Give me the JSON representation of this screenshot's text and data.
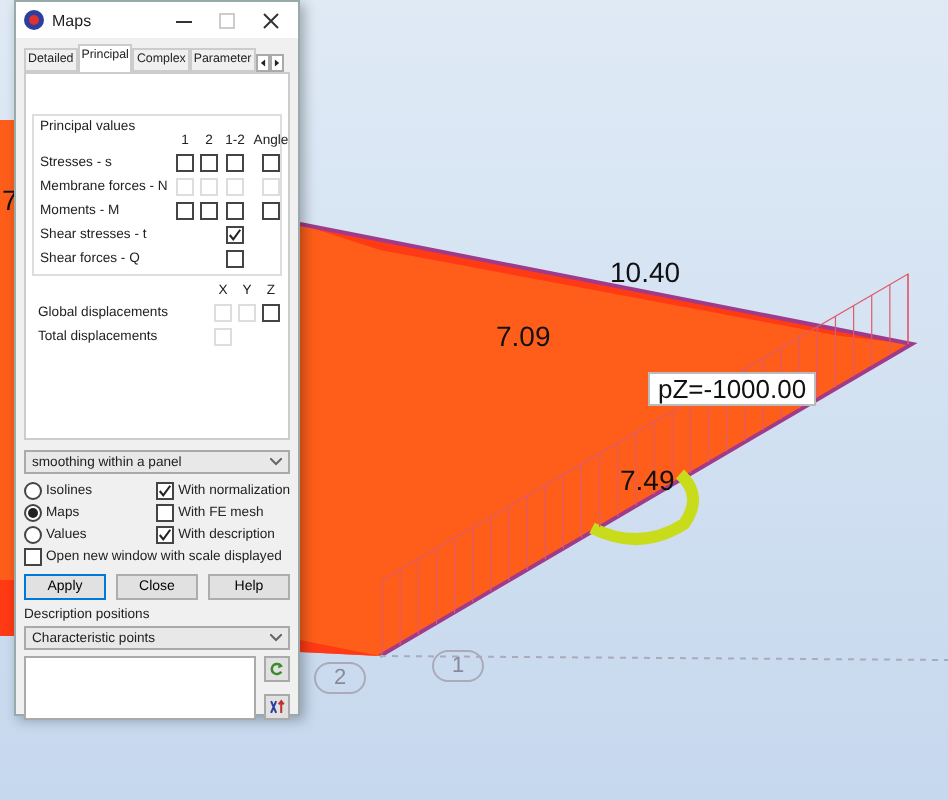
{
  "window": {
    "title": "Maps",
    "maximize_disabled": true
  },
  "tabs": [
    {
      "label": "Detailed",
      "selected": false
    },
    {
      "label": "Principal",
      "selected": true
    },
    {
      "label": "Complex",
      "selected": false
    },
    {
      "label": "Parameter",
      "selected": false
    }
  ],
  "principal_values": {
    "title": "Principal values",
    "columns": [
      "1",
      "2",
      "1-2",
      "Angle"
    ],
    "rows": [
      {
        "label": "Stresses - s",
        "cells": [
          {
            "kind": "checkbox",
            "checked": false,
            "disabled": false
          },
          {
            "kind": "checkbox",
            "checked": false,
            "disabled": false
          },
          {
            "kind": "checkbox",
            "checked": false,
            "disabled": false
          },
          {
            "kind": "checkbox",
            "checked": false,
            "disabled": false
          }
        ]
      },
      {
        "label": "Membrane forces - N",
        "cells": [
          {
            "kind": "checkbox",
            "checked": false,
            "disabled": true
          },
          {
            "kind": "checkbox",
            "checked": false,
            "disabled": true
          },
          {
            "kind": "checkbox",
            "checked": false,
            "disabled": true
          },
          {
            "kind": "checkbox",
            "checked": false,
            "disabled": true
          }
        ]
      },
      {
        "label": "Moments - M",
        "cells": [
          {
            "kind": "checkbox",
            "checked": false,
            "disabled": false
          },
          {
            "kind": "checkbox",
            "checked": false,
            "disabled": false
          },
          {
            "kind": "checkbox",
            "checked": false,
            "disabled": false
          },
          {
            "kind": "checkbox",
            "checked": false,
            "disabled": false
          }
        ]
      },
      {
        "label": "Shear stresses - t",
        "cells": [
          {
            "kind": "empty"
          },
          {
            "kind": "empty"
          },
          {
            "kind": "checkbox",
            "checked": true,
            "disabled": false
          },
          {
            "kind": "empty"
          }
        ]
      },
      {
        "label": "Shear forces - Q",
        "cells": [
          {
            "kind": "empty"
          },
          {
            "kind": "empty"
          },
          {
            "kind": "checkbox",
            "checked": false,
            "disabled": false
          },
          {
            "kind": "empty"
          }
        ]
      }
    ]
  },
  "displacements": {
    "columns": [
      "X",
      "Y",
      "Z"
    ],
    "rows": [
      {
        "label": "Global displacements",
        "cells": [
          {
            "kind": "checkbox",
            "checked": false,
            "disabled": true
          },
          {
            "kind": "checkbox",
            "checked": false,
            "disabled": true
          },
          {
            "kind": "checkbox",
            "checked": false,
            "disabled": false
          }
        ]
      },
      {
        "label": "Total displacements",
        "cells": [
          {
            "kind": "checkbox",
            "checked": false,
            "disabled": true
          },
          {
            "kind": "empty"
          },
          {
            "kind": "empty"
          }
        ]
      }
    ]
  },
  "smoothing": {
    "value": "smoothing within a panel"
  },
  "display_modes": [
    {
      "label": "Isolines",
      "selected": false
    },
    {
      "label": "Maps",
      "selected": true
    },
    {
      "label": "Values",
      "selected": false
    }
  ],
  "options": [
    {
      "label": "With normalization",
      "checked": true
    },
    {
      "label": "With FE mesh",
      "checked": false
    },
    {
      "label": "With description",
      "checked": true
    }
  ],
  "open_new_window": {
    "label": "Open new window with scale displayed",
    "checked": false
  },
  "buttons": [
    {
      "label": "Apply",
      "default": true
    },
    {
      "label": "Close",
      "default": false
    },
    {
      "label": "Help",
      "default": false
    }
  ],
  "description_positions": {
    "label": "Description positions",
    "value": "Characteristic points"
  },
  "canvas": {
    "edge_label": "7",
    "labels": [
      {
        "text": "10.40",
        "kind": "value"
      },
      {
        "text": "7.09",
        "kind": "value"
      },
      {
        "text": "pZ=-1000.00",
        "kind": "load"
      },
      {
        "text": "7.49",
        "kind": "value"
      }
    ],
    "nodes": [
      "2",
      "1"
    ]
  }
}
